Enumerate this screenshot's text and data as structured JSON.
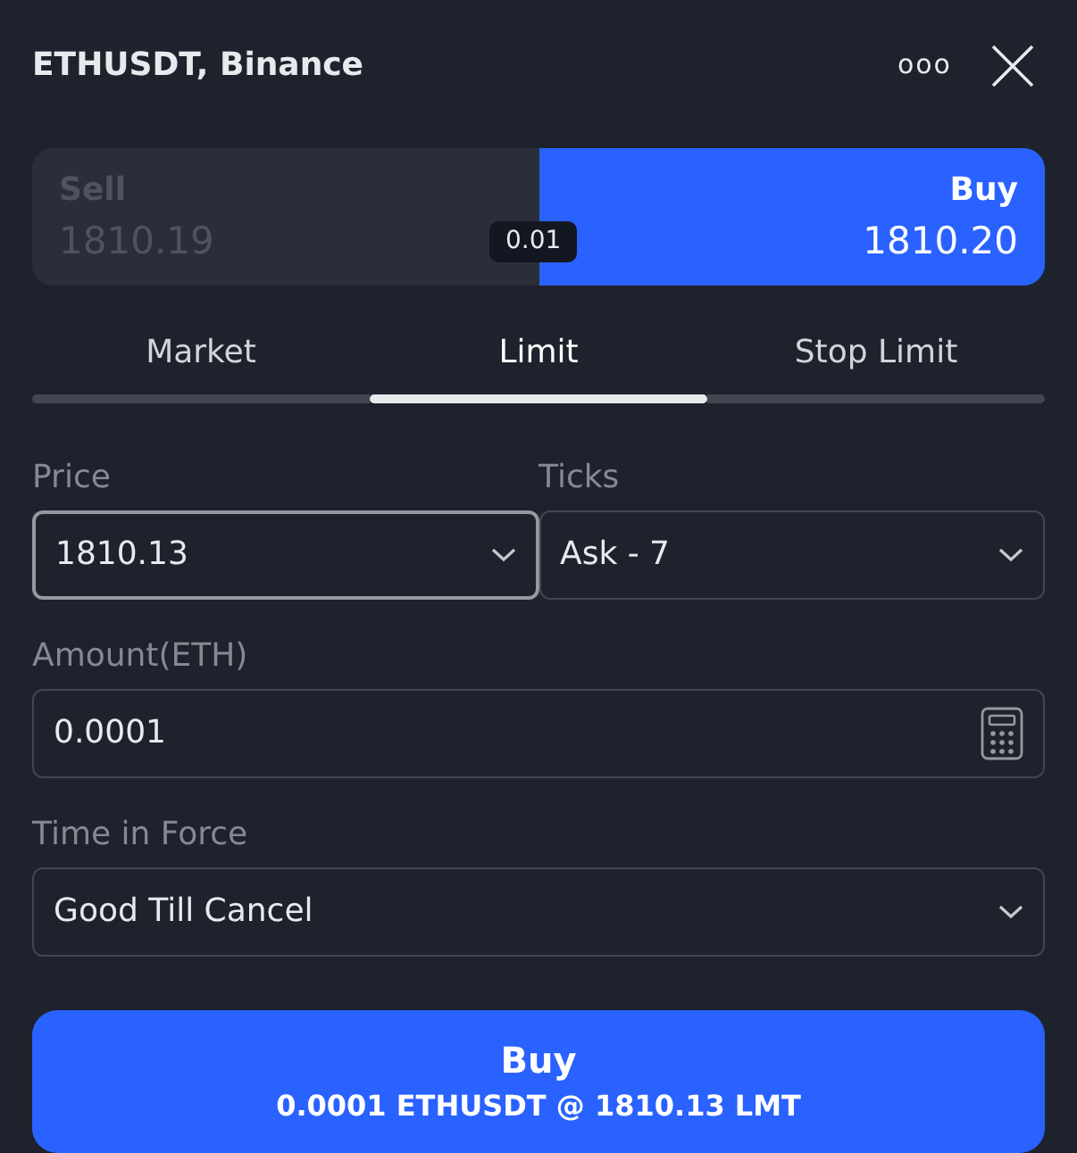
{
  "header": {
    "title": "ETHUSDT, Binance",
    "more": "ooo"
  },
  "sides": [
    {
      "label": "Sell",
      "price": "1810.19",
      "selected": false
    },
    {
      "label": "Buy",
      "price": "1810.20",
      "selected": true
    }
  ],
  "spread": "0.01",
  "order_types": [
    {
      "label": "Market",
      "selected": false
    },
    {
      "label": "Limit",
      "selected": true
    },
    {
      "label": "Stop Limit",
      "selected": false
    }
  ],
  "price_row": [
    {
      "label": "Price",
      "value": "1810.13",
      "kind": "select",
      "focused": true
    },
    {
      "label": "Ticks",
      "value": "Ask - 7",
      "kind": "select",
      "focused": false
    }
  ],
  "amount": {
    "label": "Amount(ETH)",
    "value": "0.0001",
    "kind": "calculator",
    "focused": false
  },
  "time_in_force": {
    "label": "Time in Force",
    "value": "Good Till Cancel",
    "kind": "select",
    "focused": false
  },
  "submit": {
    "label": "Buy",
    "summary": "0.0001 ETHUSDT @ 1810.13 LMT"
  }
}
